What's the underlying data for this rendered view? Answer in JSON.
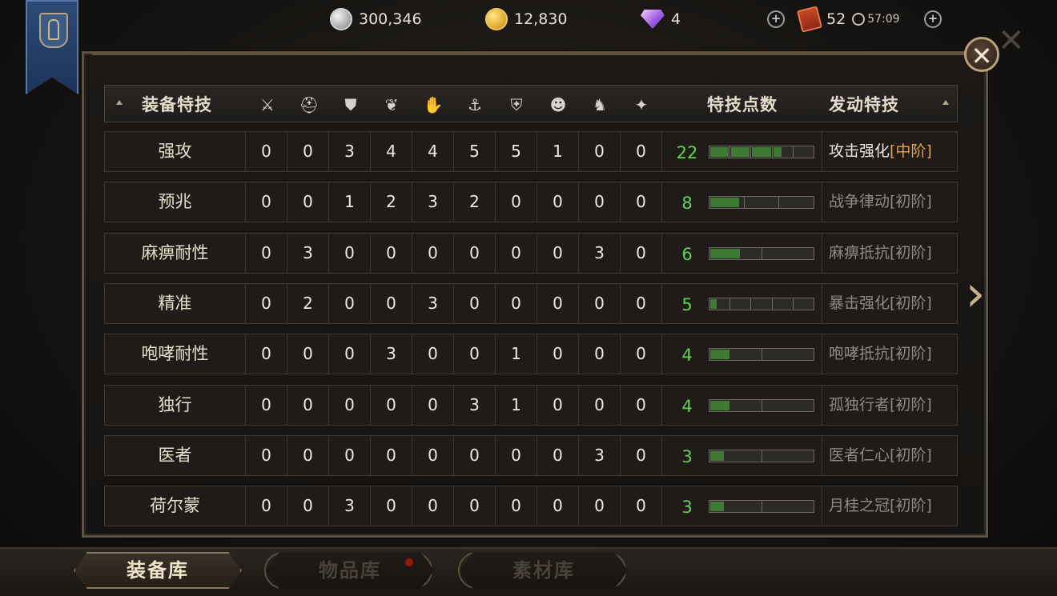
{
  "top_bar": {
    "silver": "300,346",
    "gold": "12,830",
    "gems": "4",
    "books": "52",
    "timer": "57:09"
  },
  "header": {
    "skill_col": "装备特技",
    "points_col": "特技点数",
    "active_col": "发动特技",
    "slot_icons": [
      "sword-icon",
      "helmet-icon",
      "chest-armor-icon",
      "shoulder-armor-icon",
      "arm-armor-icon",
      "greaves-icon",
      "shield-icon",
      "mask-icon",
      "knight-icon",
      "talisman-icon"
    ]
  },
  "rows": [
    {
      "name": "强攻",
      "vals": [
        "0",
        "0",
        "3",
        "4",
        "4",
        "5",
        "5",
        "1",
        "0",
        "0"
      ],
      "points": "22",
      "filled": 3.5,
      "segments": 5,
      "active": "攻击强化",
      "level": "[中阶]",
      "on": true
    },
    {
      "name": "预兆",
      "vals": [
        "0",
        "0",
        "1",
        "2",
        "3",
        "2",
        "0",
        "0",
        "0",
        "0"
      ],
      "points": "8",
      "filled": 0.9,
      "segments": 3,
      "active": "战争律动",
      "level": "[初阶]",
      "on": false
    },
    {
      "name": "麻痹耐性",
      "vals": [
        "0",
        "3",
        "0",
        "0",
        "0",
        "0",
        "0",
        "0",
        "3",
        "0"
      ],
      "points": "6",
      "filled": 0.6,
      "segments": 2,
      "active": "麻痹抵抗",
      "level": "[初阶]",
      "on": false
    },
    {
      "name": "精准",
      "vals": [
        "0",
        "2",
        "0",
        "0",
        "3",
        "0",
        "0",
        "0",
        "0",
        "0"
      ],
      "points": "5",
      "filled": 0.4,
      "segments": 5,
      "active": "暴击强化",
      "level": "[初阶]",
      "on": false
    },
    {
      "name": "咆哮耐性",
      "vals": [
        "0",
        "0",
        "0",
        "3",
        "0",
        "0",
        "1",
        "0",
        "0",
        "0"
      ],
      "points": "4",
      "filled": 0.4,
      "segments": 2,
      "active": "咆哮抵抗",
      "level": "[初阶]",
      "on": false
    },
    {
      "name": "独行",
      "vals": [
        "0",
        "0",
        "0",
        "0",
        "0",
        "3",
        "1",
        "0",
        "0",
        "0"
      ],
      "points": "4",
      "filled": 0.4,
      "segments": 2,
      "active": "孤独行者",
      "level": "[初阶]",
      "on": false
    },
    {
      "name": "医者",
      "vals": [
        "0",
        "0",
        "0",
        "0",
        "0",
        "0",
        "0",
        "0",
        "3",
        "0"
      ],
      "points": "3",
      "filled": 0.3,
      "segments": 2,
      "active": "医者仁心",
      "level": "[初阶]",
      "on": false
    },
    {
      "name": "荷尔蒙",
      "vals": [
        "0",
        "0",
        "3",
        "0",
        "0",
        "0",
        "0",
        "0",
        "0",
        "0"
      ],
      "points": "3",
      "filled": 0.3,
      "segments": 2,
      "active": "月桂之冠",
      "level": "[初阶]",
      "on": false
    }
  ],
  "tabs": [
    "装备库",
    "物品库",
    "素材库"
  ]
}
